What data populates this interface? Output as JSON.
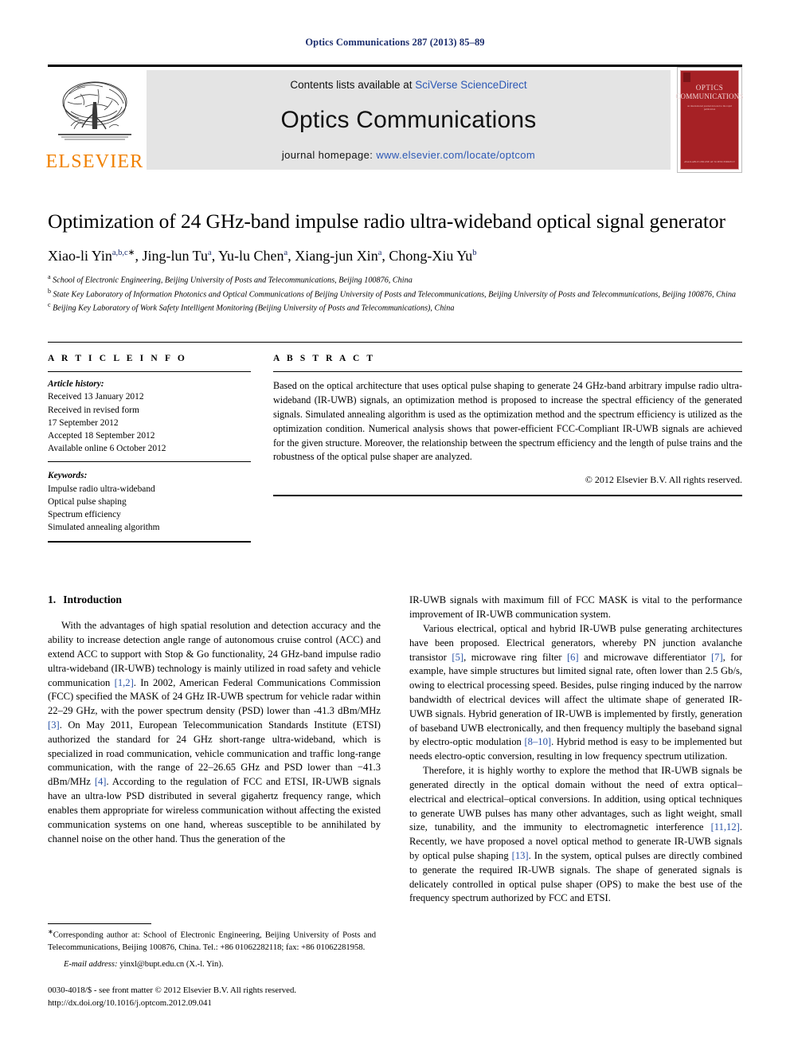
{
  "running_head": "Optics Communications 287 (2013) 85–89",
  "masthead": {
    "publisher_name": "ELSEVIER",
    "contents_prefix": "Contents lists available at ",
    "contents_link": "SciVerse ScienceDirect",
    "journal_title": "Optics Communications",
    "homepage_prefix": "journal homepage: ",
    "homepage_link": "www.elsevier.com/locate/optcom",
    "cover": {
      "line1": "OPTICS",
      "line2": "COMMUNICATIONS",
      "subtitle": "an international journal devoted to the rapid publication",
      "footer": "AVAILABLE ONLINE AT\nSCIENCEDIRECT"
    }
  },
  "article": {
    "title": "Optimization of 24 GHz-band impulse radio ultra-wideband optical signal generator",
    "authors": [
      {
        "name": "Xiao-li Yin",
        "marks": "a,b,c",
        "star": true
      },
      {
        "name": "Jing-lun Tu",
        "marks": "a",
        "star": false
      },
      {
        "name": "Yu-lu Chen",
        "marks": "a",
        "star": false
      },
      {
        "name": "Xiang-jun Xin",
        "marks": "a",
        "star": false
      },
      {
        "name": "Chong-Xiu Yu",
        "marks": "b",
        "star": false
      }
    ],
    "affiliations": [
      {
        "mark": "a",
        "text": "School of Electronic Engineering, Beijing University of Posts and Telecommunications, Beijing 100876, China"
      },
      {
        "mark": "b",
        "text": "State Key Laboratory of Information Photonics and Optical Communications of Beijing University of Posts and Telecommunications, Beijing University of Posts and Telecommunications, Beijing 100876, China"
      },
      {
        "mark": "c",
        "text": "Beijing Key Laboratory of Work Safety Intelligent Monitoring (Beijing University of Posts and Telecommunications), China"
      }
    ]
  },
  "article_info": {
    "heading": "A R T I C L E  I N F O",
    "history_label": "Article history:",
    "history": [
      "Received 13 January 2012",
      "Received in revised form",
      "17 September 2012",
      "Accepted 18 September 2012",
      "Available online 6 October 2012"
    ],
    "keywords_label": "Keywords:",
    "keywords": [
      "Impulse radio ultra-wideband",
      "Optical pulse shaping",
      "Spectrum efficiency",
      "Simulated annealing algorithm"
    ]
  },
  "abstract": {
    "heading": "A B S T R A C T",
    "text": "Based on the optical architecture that uses optical pulse shaping to generate 24 GHz-band arbitrary impulse radio ultra-wideband (IR-UWB) signals, an optimization method is proposed to increase the spectral efficiency of the generated signals. Simulated annealing algorithm is used as the optimization method and the spectrum efficiency is utilized as the optimization condition. Numerical analysis shows that power-efficient FCC-Compliant IR-UWB signals are achieved for the given structure. Moreover, the relationship between the spectrum efficiency and the length of pulse trains and the robustness of the optical pulse shaper are analyzed.",
    "copyright": "© 2012 Elsevier B.V. All rights reserved."
  },
  "body": {
    "section_number": "1.",
    "section_title": "Introduction",
    "left_paragraphs": [
      "With the advantages of high spatial resolution and detection accuracy and the ability to increase detection angle range of autonomous cruise control (ACC) and extend ACC to support with Stop & Go functionality, 24 GHz-band impulse radio ultra-wideband (IR-UWB) technology is mainly utilized in road safety and vehicle communication [1,2]. In 2002, American Federal Communications Commission (FCC) specified the MASK of 24 GHz IR-UWB spectrum for vehicle radar within 22–29 GHz, with the power spectrum density (PSD) lower than -41.3 dBm/MHz [3]. On May 2011, European Telecommunication Standards Institute (ETSI) authorized the standard for 24 GHz short-range ultra-wideband, which is specialized in road communication, vehicle communication and traffic long-range communication, with the range of 22–26.65 GHz and PSD lower than −41.3 dBm/MHz [4]. According to the regulation of FCC and ETSI, IR-UWB signals have an ultra-low PSD distributed in several gigahertz frequency range, which enables them appropriate for wireless communication without affecting the existed communication systems on one hand, whereas susceptible to be annihilated by channel noise on the other hand. Thus the generation of the"
    ],
    "right_paragraphs": [
      "IR-UWB signals with maximum fill of FCC MASK is vital to the performance improvement of IR-UWB communication system.",
      "Various electrical, optical and hybrid IR-UWB pulse generating architectures have been proposed. Electrical generators, whereby PN junction avalanche transistor [5], microwave ring filter [6] and microwave differentiator [7], for example, have simple structures but limited signal rate, often lower than 2.5 Gb/s, owing to electrical processing speed. Besides, pulse ringing induced by the narrow bandwidth of electrical devices will affect the ultimate shape of generated IR-UWB signals. Hybrid generation of IR-UWB is implemented by firstly, generation of baseband UWB electronically, and then frequency multiply the baseband signal by electro-optic modulation [8–10]. Hybrid method is easy to be implemented but needs electro-optic conversion, resulting in low frequency spectrum utilization.",
      "Therefore, it is highly worthy to explore the method that IR-UWB signals be generated directly in the optical domain without the need of extra optical–electrical and electrical–optical conversions. In addition, using optical techniques to generate UWB pulses has many other advantages, such as light weight, small size, tunability, and the immunity to electromagnetic interference [11,12]. Recently, we have proposed a novel optical method to generate IR-UWB signals by optical pulse shaping [13]. In the system, optical pulses are directly combined to generate the required IR-UWB signals. The shape of generated signals is delicately controlled in optical pulse shaper (OPS) to make the best use of the frequency spectrum authorized by FCC and ETSI."
    ]
  },
  "footnote": {
    "corresponding": "Corresponding author at: School of Electronic Engineering, Beijing University of Posts and Telecommunications, Beijing 100876, China. Tel.: +86 01062282118; fax: +86 01062281958.",
    "email_label": "E-mail address:",
    "email": "yinxl@bupt.edu.cn (X.-l. Yin).",
    "issn_line": "0030-4018/$ - see front matter © 2012 Elsevier B.V. All rights reserved.",
    "doi_line": "http://dx.doi.org/10.1016/j.optcom.2012.09.041"
  },
  "colors": {
    "link_blue": "#2c58b5",
    "ref_blue": "#2a52a5",
    "running_head_blue": "#1c2e6e",
    "elsevier_orange": "#f08000",
    "cover_red": "#a62125",
    "band_gray": "#e4e4e4"
  }
}
